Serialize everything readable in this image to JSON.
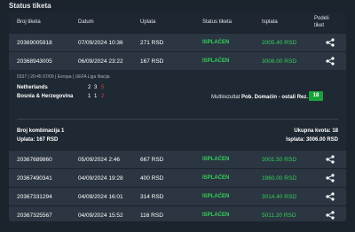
{
  "page_title": "Status tiketa",
  "columns": {
    "ticket_no": "Broj tiketa",
    "date": "Datum",
    "stake": "Uplata",
    "status": "Status tiketa",
    "payout": "Isplata",
    "share": "Podeli tiket"
  },
  "colors": {
    "accent_green": "#33d15a",
    "badge_green": "#1aa23a",
    "red_score": "#e23b3b"
  },
  "rows": [
    {
      "ticket_no": "20369005918",
      "date": "07/09/2024 10:36",
      "stake": "271 RSD",
      "status": "ISPLAĆEN",
      "payout": "2005.40 RSD"
    },
    {
      "ticket_no": "20368943005",
      "date": "06/09/2024 23:22",
      "stake": "167 RSD",
      "status": "ISPLAĆEN",
      "payout": "3006.00 RSD"
    },
    {
      "ticket_no": "20367689860",
      "date": "05/09/2024 2:46",
      "stake": "667 RSD",
      "status": "ISPLAĆEN",
      "payout": "3001.50 RSD"
    },
    {
      "ticket_no": "20367490341",
      "date": "04/09/2024 19:28",
      "stake": "400 RSD",
      "status": "ISPLAĆEN",
      "payout": "1960.00 RSD"
    },
    {
      "ticket_no": "20367331294",
      "date": "04/09/2024 16:01",
      "stake": "314 RSD",
      "status": "ISPLAĆEN",
      "payout": "3014.40 RSD"
    },
    {
      "ticket_no": "20367325567",
      "date": "04/09/2024 15:52",
      "stake": "116 RSD",
      "status": "ISPLAĆEN",
      "payout": "5011.20 RSD"
    }
  ],
  "details": {
    "meta": "0337 | 20:45 07/09 | Evropa | UEFA Liga Nacija",
    "home_team": "Netherlands",
    "away_team": "Bosnia & Herzegovina",
    "home_scores": [
      "2",
      "3",
      "5"
    ],
    "away_scores": [
      "1",
      "1",
      "2"
    ],
    "market_label": "Multirezultat",
    "market_pick": "Pob. Domaćin - ostali Rez.",
    "odd": "18",
    "combinations": "Broj kombinacija 1",
    "stake_line": "Uplata: 167 RSD",
    "total_odd": "Ukupna kvota: 18",
    "payout_line": "Isplata: 3006.00 RSD"
  }
}
